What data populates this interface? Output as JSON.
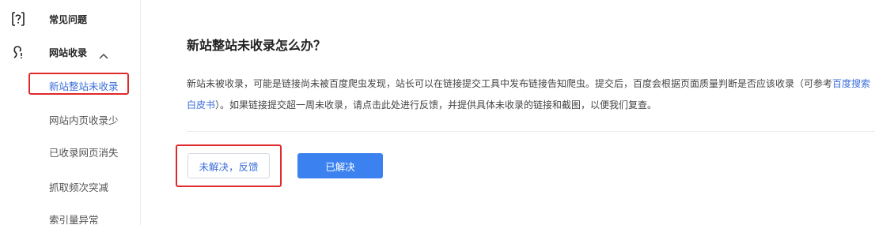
{
  "sidebar": {
    "faq": {
      "label": "常见问题",
      "icon": "question-icon"
    },
    "site_index": {
      "label": "网站收录",
      "icon": "spider-icon",
      "chevron": "chevron-up-icon"
    },
    "items": [
      {
        "label": "新站整站未收录",
        "active": true
      },
      {
        "label": "网站内页收录少"
      },
      {
        "label": "已收录网页消失"
      },
      {
        "label": "抓取频次突减"
      },
      {
        "label": "索引量异常"
      }
    ]
  },
  "article": {
    "title": "新站整站未收录怎么办？",
    "para_part1": "新站未被收录，可能是链接尚未被百度爬虫发现，站长可以在链接提交工具中发布链接告知爬虫。提交后，百度会根据页面质量判断是否应该收录（可参考",
    "link_text": "百度搜索白皮书",
    "para_part2": "）。如果链接提交超一周未收录，请点击此处进行反馈，并提供具体未收录的链接和截图，以便我们复查。"
  },
  "actions": {
    "unresolved_label": "未解决，反馈",
    "resolved_label": "已解决"
  },
  "colors": {
    "accent": "#3b6ed8",
    "primary_button": "#3b82f0",
    "highlight_border": "#e0292b"
  }
}
